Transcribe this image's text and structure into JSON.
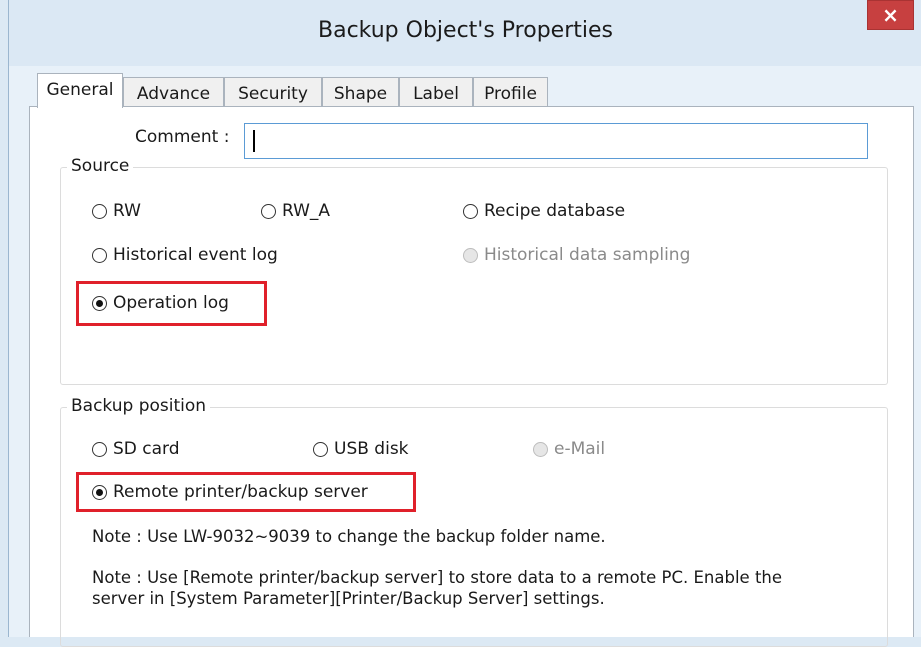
{
  "window": {
    "title": "Backup Object's Properties",
    "close_glyph": "×"
  },
  "tabs": [
    {
      "label": "General",
      "active": true
    },
    {
      "label": "Advance",
      "active": false
    },
    {
      "label": "Security",
      "active": false
    },
    {
      "label": "Shape",
      "active": false
    },
    {
      "label": "Label",
      "active": false
    },
    {
      "label": "Profile",
      "active": false
    }
  ],
  "comment": {
    "label": "Comment :",
    "value": ""
  },
  "source": {
    "title": "Source",
    "options": [
      {
        "label": "RW",
        "checked": false,
        "disabled": false
      },
      {
        "label": "RW_A",
        "checked": false,
        "disabled": false
      },
      {
        "label": "Recipe database",
        "checked": false,
        "disabled": false
      },
      {
        "label": "Historical event log",
        "checked": false,
        "disabled": false
      },
      {
        "label": "Historical data sampling",
        "checked": false,
        "disabled": true
      },
      {
        "label": "Operation log",
        "checked": true,
        "disabled": false
      }
    ]
  },
  "backup_position": {
    "title": "Backup position",
    "options": [
      {
        "label": "SD card",
        "checked": false,
        "disabled": false
      },
      {
        "label": "USB disk",
        "checked": false,
        "disabled": false
      },
      {
        "label": "e-Mail",
        "checked": false,
        "disabled": true
      },
      {
        "label": "Remote printer/backup server",
        "checked": true,
        "disabled": false
      }
    ],
    "note1": "Note : Use LW-9032~9039 to change the backup folder name.",
    "note2_line1": "Note : Use [Remote printer/backup server] to store data to a remote PC. Enable the",
    "note2_line2": "server in [System Parameter][Printer/Backup Server] settings."
  },
  "colors": {
    "highlight": "#e0202a",
    "close_button": "#c74040",
    "input_border": "#5b9bd5"
  }
}
